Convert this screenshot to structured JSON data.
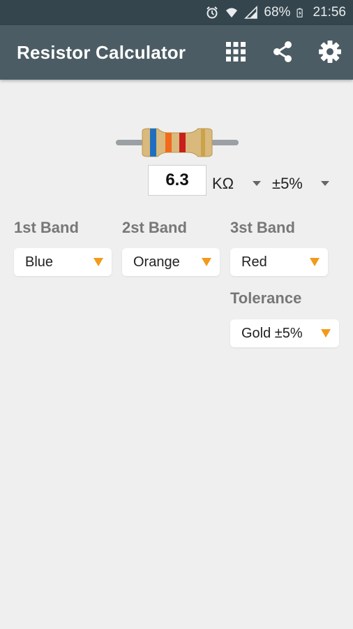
{
  "status_bar": {
    "battery": "68%",
    "time": "21:56",
    "icons": [
      "alarm-icon",
      "wifi-icon",
      "signal-icon",
      "battery-charging-icon"
    ]
  },
  "app_bar": {
    "title": "Resistor Calculator",
    "actions": [
      "grid-icon",
      "share-icon",
      "settings-icon"
    ],
    "background": "#4b5c64"
  },
  "resistor": {
    "bands": [
      "Blue",
      "Orange",
      "Red"
    ],
    "tolerance_band": "Gold",
    "band_colors": [
      "#1f6fc0",
      "#f26a1b",
      "#c8201c"
    ],
    "tolerance_color": "#c9a24a"
  },
  "value": {
    "number": "6.3",
    "unit": "KΩ",
    "tolerance": "±5%"
  },
  "bands": {
    "first": {
      "label": "1st Band",
      "selected": "Blue"
    },
    "second": {
      "label": "2st Band",
      "selected": "Orange"
    },
    "third": {
      "label": "3st Band",
      "selected": "Red"
    },
    "tolerance": {
      "label": "Tolerance",
      "selected": "Gold ±5%"
    }
  },
  "accent": "#f29a1a"
}
